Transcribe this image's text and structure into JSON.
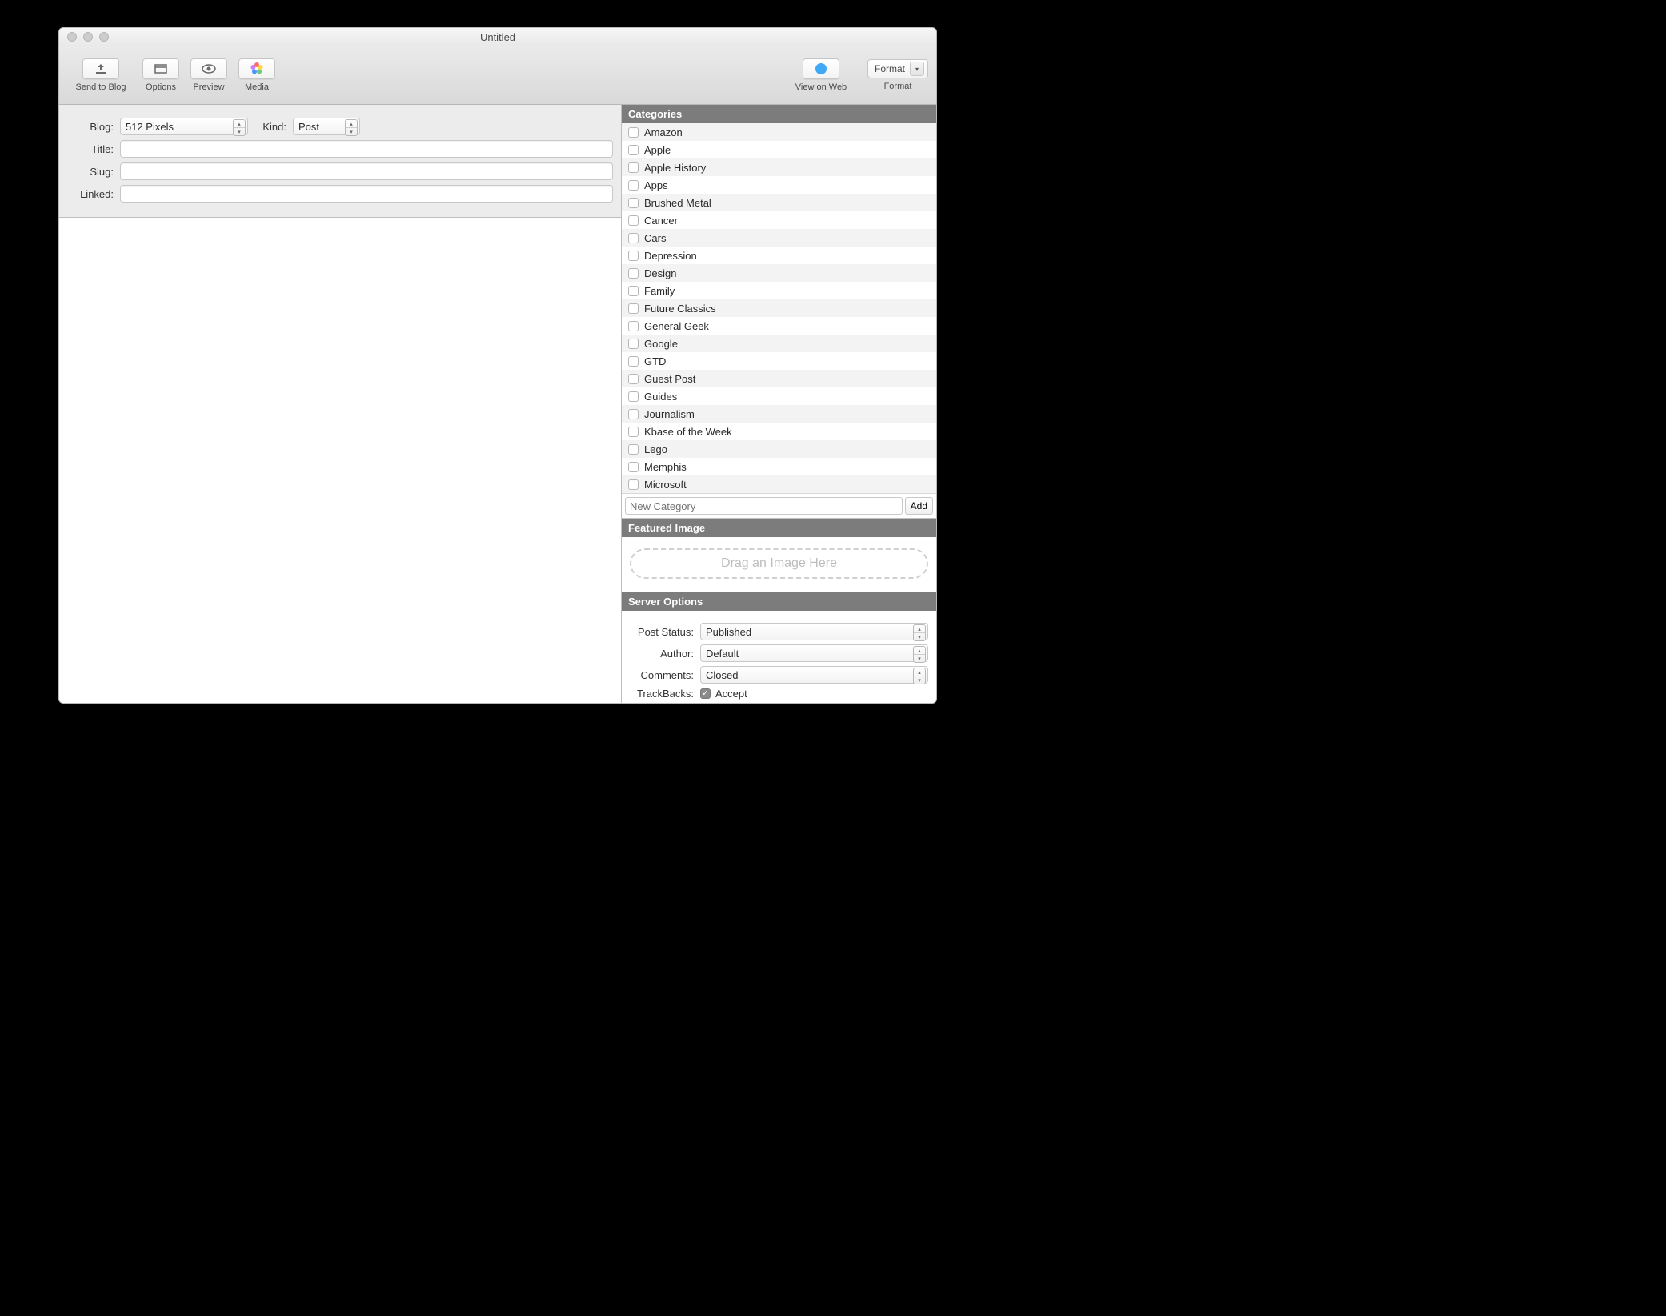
{
  "window": {
    "title": "Untitled"
  },
  "toolbar": {
    "left": [
      {
        "name": "send-to-blog-button",
        "label": "Send to Blog",
        "icon": "upload-icon"
      },
      {
        "name": "options-button",
        "label": "Options",
        "icon": "panel-icon"
      },
      {
        "name": "preview-button",
        "label": "Preview",
        "icon": "eye-icon"
      },
      {
        "name": "media-button",
        "label": "Media",
        "icon": "flower-icon"
      }
    ],
    "right": [
      {
        "name": "view-on-web-button",
        "label": "View on Web",
        "icon": "safari-icon"
      }
    ],
    "format_dropdown": {
      "label": "Format",
      "sublabel": "Format"
    }
  },
  "form": {
    "blog_label": "Blog:",
    "blog_value": "512 Pixels",
    "kind_label": "Kind:",
    "kind_value": "Post",
    "title_label": "Title:",
    "title_value": "",
    "slug_label": "Slug:",
    "slug_value": "",
    "linked_label": "Linked:",
    "linked_value": ""
  },
  "sidebar": {
    "categories_header": "Categories",
    "categories": [
      "Amazon",
      "Apple",
      "Apple History",
      "Apps",
      "Brushed Metal",
      "Cancer",
      "Cars",
      "Depression",
      "Design",
      "Family",
      "Future Classics",
      "General Geek",
      "Google",
      "GTD",
      "Guest Post",
      "Guides",
      "Journalism",
      "Kbase of the Week",
      "Lego",
      "Memphis",
      "Microsoft"
    ],
    "new_category_placeholder": "New Category",
    "add_button": "Add",
    "featured_header": "Featured Image",
    "dropzone_text": "Drag an Image Here",
    "server_header": "Server Options",
    "server": {
      "post_status_label": "Post Status:",
      "post_status_value": "Published",
      "author_label": "Author:",
      "author_value": "Default",
      "comments_label": "Comments:",
      "comments_value": "Closed",
      "trackbacks_label": "TrackBacks:",
      "trackbacks_accept": "Accept"
    }
  }
}
